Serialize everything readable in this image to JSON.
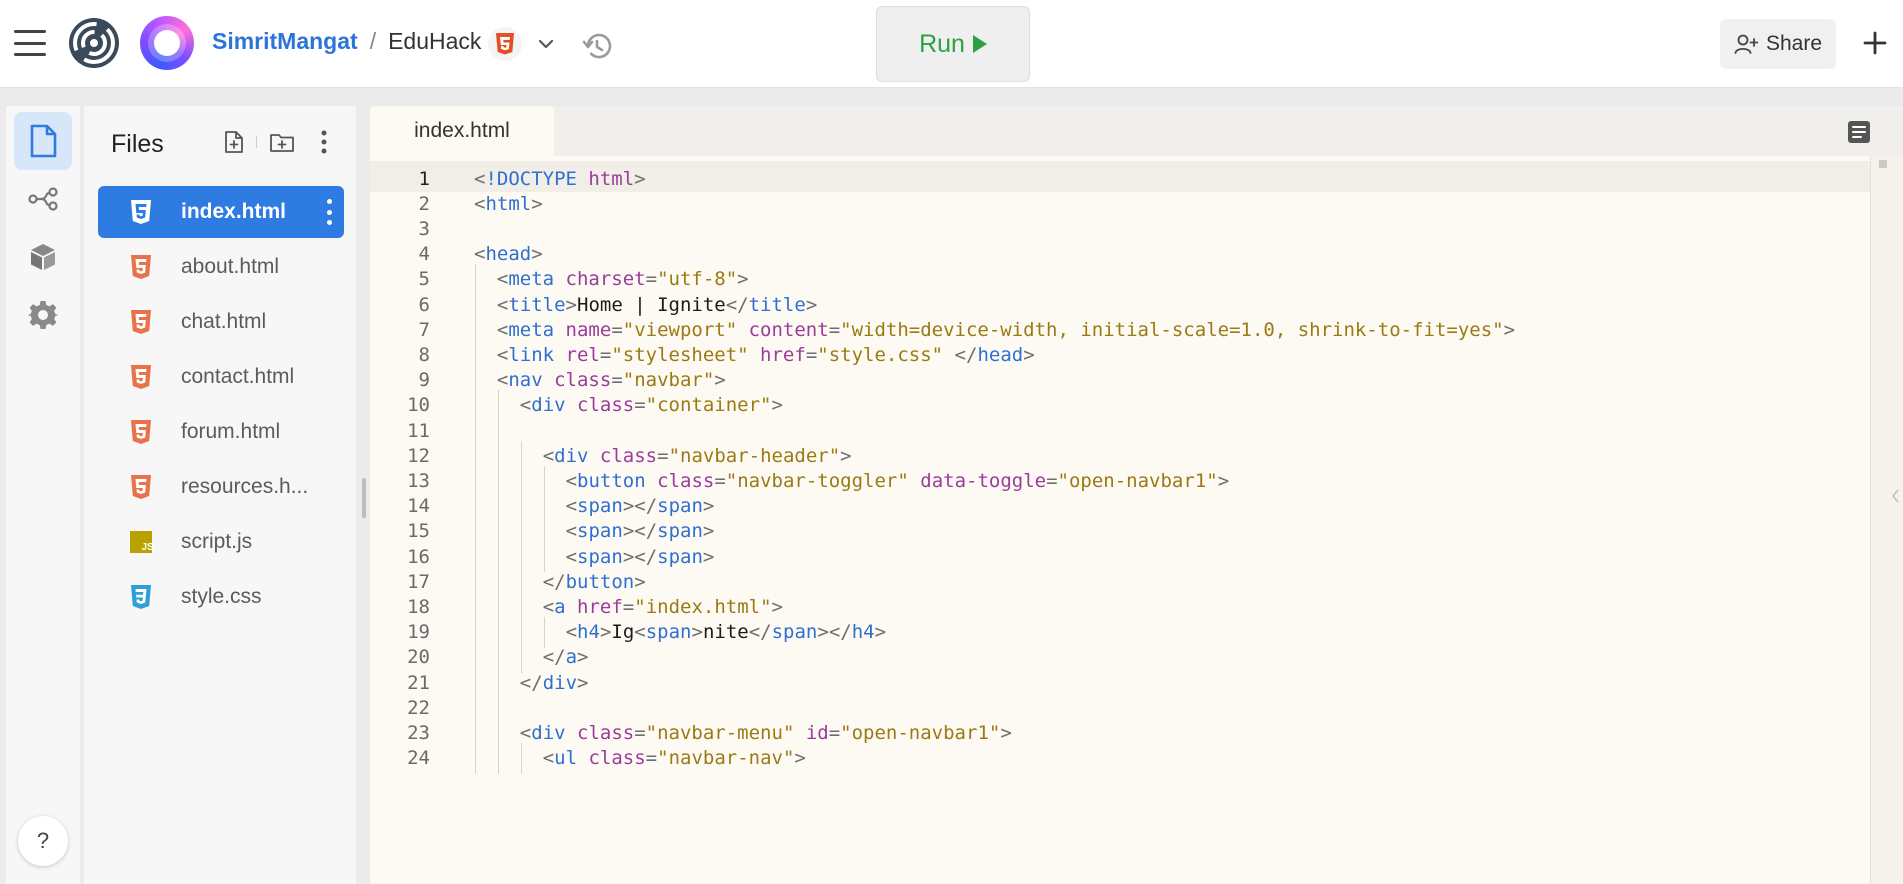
{
  "topbar": {
    "user": "SimritMangat",
    "separator": "/",
    "project": "EduHack",
    "run_label": "Run",
    "share_label": "Share"
  },
  "rail": {
    "items": [
      {
        "name": "files-icon",
        "active": true
      },
      {
        "name": "git-icon",
        "active": false
      },
      {
        "name": "packages-icon",
        "active": false
      },
      {
        "name": "settings-icon",
        "active": false
      }
    ],
    "help_label": "?"
  },
  "files": {
    "title": "Files",
    "items": [
      {
        "label": "index.html",
        "type": "html",
        "active": true
      },
      {
        "label": "about.html",
        "type": "html",
        "active": false
      },
      {
        "label": "chat.html",
        "type": "html",
        "active": false
      },
      {
        "label": "contact.html",
        "type": "html",
        "active": false
      },
      {
        "label": "forum.html",
        "type": "html",
        "active": false
      },
      {
        "label": "resources.h...",
        "type": "html",
        "active": false
      },
      {
        "label": "script.js",
        "type": "js",
        "active": false
      },
      {
        "label": "style.css",
        "type": "css",
        "active": false
      }
    ]
  },
  "editor": {
    "tab_label": "index.html",
    "current_line": 1,
    "lines": [
      {
        "n": "1",
        "indent": 0,
        "tokens": [
          [
            "b",
            "<"
          ],
          [
            "t",
            "!DOCTYPE "
          ],
          [
            "a",
            "html"
          ],
          [
            "b",
            ">"
          ]
        ]
      },
      {
        "n": "2",
        "indent": 0,
        "tokens": [
          [
            "b",
            "<"
          ],
          [
            "t",
            "html"
          ],
          [
            "b",
            ">"
          ]
        ]
      },
      {
        "n": "3",
        "indent": 0,
        "tokens": []
      },
      {
        "n": "4",
        "indent": 0,
        "tokens": [
          [
            "b",
            "<"
          ],
          [
            "t",
            "head"
          ],
          [
            "b",
            ">"
          ]
        ]
      },
      {
        "n": "5",
        "indent": 1,
        "tokens": [
          [
            "b",
            "<"
          ],
          [
            "t",
            "meta "
          ],
          [
            "a",
            "charset"
          ],
          [
            "b",
            "="
          ],
          [
            "s",
            "\"utf-8\""
          ],
          [
            "b",
            ">"
          ]
        ]
      },
      {
        "n": "6",
        "indent": 1,
        "tokens": [
          [
            "b",
            "<"
          ],
          [
            "t",
            "title"
          ],
          [
            "b",
            ">"
          ],
          [
            "x",
            "Home | Ignite"
          ],
          [
            "b",
            "</"
          ],
          [
            "t",
            "title"
          ],
          [
            "b",
            ">"
          ]
        ]
      },
      {
        "n": "7",
        "indent": 1,
        "tokens": [
          [
            "b",
            "<"
          ],
          [
            "t",
            "meta "
          ],
          [
            "a",
            "name"
          ],
          [
            "b",
            "="
          ],
          [
            "s",
            "\"viewport\" "
          ],
          [
            "a",
            "content"
          ],
          [
            "b",
            "="
          ],
          [
            "s",
            "\"width=device-width, initial-scale=1.0, shrink-to-fit=yes\""
          ],
          [
            "b",
            ">"
          ]
        ]
      },
      {
        "n": "8",
        "indent": 1,
        "tokens": [
          [
            "b",
            "<"
          ],
          [
            "t",
            "link "
          ],
          [
            "a",
            "rel"
          ],
          [
            "b",
            "="
          ],
          [
            "s",
            "\"stylesheet\" "
          ],
          [
            "a",
            "href"
          ],
          [
            "b",
            "="
          ],
          [
            "s",
            "\"style.css\" "
          ],
          [
            "b",
            "</"
          ],
          [
            "t",
            "head"
          ],
          [
            "b",
            ">"
          ]
        ]
      },
      {
        "n": "9",
        "indent": 1,
        "tokens": [
          [
            "b",
            "<"
          ],
          [
            "t",
            "nav "
          ],
          [
            "a",
            "class"
          ],
          [
            "b",
            "="
          ],
          [
            "s",
            "\"navbar\""
          ],
          [
            "b",
            ">"
          ]
        ]
      },
      {
        "n": "10",
        "indent": 2,
        "tokens": [
          [
            "b",
            "<"
          ],
          [
            "t",
            "div "
          ],
          [
            "a",
            "class"
          ],
          [
            "b",
            "="
          ],
          [
            "s",
            "\"container\""
          ],
          [
            "b",
            ">"
          ]
        ]
      },
      {
        "n": "11",
        "indent": 2,
        "tokens": []
      },
      {
        "n": "12",
        "indent": 3,
        "tokens": [
          [
            "b",
            "<"
          ],
          [
            "t",
            "div "
          ],
          [
            "a",
            "class"
          ],
          [
            "b",
            "="
          ],
          [
            "s",
            "\"navbar-header\""
          ],
          [
            "b",
            ">"
          ]
        ]
      },
      {
        "n": "13",
        "indent": 4,
        "tokens": [
          [
            "b",
            "<"
          ],
          [
            "t",
            "button "
          ],
          [
            "a",
            "class"
          ],
          [
            "b",
            "="
          ],
          [
            "s",
            "\"navbar-toggler\" "
          ],
          [
            "a",
            "data-toggle"
          ],
          [
            "b",
            "="
          ],
          [
            "s",
            "\"open-navbar1\""
          ],
          [
            "b",
            ">"
          ]
        ]
      },
      {
        "n": "14",
        "indent": 4,
        "tokens": [
          [
            "b",
            "<"
          ],
          [
            "t",
            "span"
          ],
          [
            "b",
            "></"
          ],
          [
            "t",
            "span"
          ],
          [
            "b",
            ">"
          ]
        ]
      },
      {
        "n": "15",
        "indent": 4,
        "tokens": [
          [
            "b",
            "<"
          ],
          [
            "t",
            "span"
          ],
          [
            "b",
            "></"
          ],
          [
            "t",
            "span"
          ],
          [
            "b",
            ">"
          ]
        ]
      },
      {
        "n": "16",
        "indent": 4,
        "tokens": [
          [
            "b",
            "<"
          ],
          [
            "t",
            "span"
          ],
          [
            "b",
            "></"
          ],
          [
            "t",
            "span"
          ],
          [
            "b",
            ">"
          ]
        ]
      },
      {
        "n": "17",
        "indent": 3,
        "tokens": [
          [
            "b",
            "</"
          ],
          [
            "t",
            "button"
          ],
          [
            "b",
            ">"
          ]
        ]
      },
      {
        "n": "18",
        "indent": 3,
        "tokens": [
          [
            "b",
            "<"
          ],
          [
            "t",
            "a "
          ],
          [
            "a",
            "href"
          ],
          [
            "b",
            "="
          ],
          [
            "s",
            "\"index.html\""
          ],
          [
            "b",
            ">"
          ]
        ]
      },
      {
        "n": "19",
        "indent": 4,
        "tokens": [
          [
            "b",
            "<"
          ],
          [
            "t",
            "h4"
          ],
          [
            "b",
            ">"
          ],
          [
            "x",
            "Ig"
          ],
          [
            "b",
            "<"
          ],
          [
            "t",
            "span"
          ],
          [
            "b",
            ">"
          ],
          [
            "x",
            "nite"
          ],
          [
            "b",
            "</"
          ],
          [
            "t",
            "span"
          ],
          [
            "b",
            "></"
          ],
          [
            "t",
            "h4"
          ],
          [
            "b",
            ">"
          ]
        ]
      },
      {
        "n": "20",
        "indent": 3,
        "tokens": [
          [
            "b",
            "</"
          ],
          [
            "t",
            "a"
          ],
          [
            "b",
            ">"
          ]
        ]
      },
      {
        "n": "21",
        "indent": 2,
        "tokens": [
          [
            "b",
            "</"
          ],
          [
            "t",
            "div"
          ],
          [
            "b",
            ">"
          ]
        ]
      },
      {
        "n": "22",
        "indent": 2,
        "tokens": []
      },
      {
        "n": "23",
        "indent": 2,
        "tokens": [
          [
            "b",
            "<"
          ],
          [
            "t",
            "div "
          ],
          [
            "a",
            "class"
          ],
          [
            "b",
            "="
          ],
          [
            "s",
            "\"navbar-menu\" "
          ],
          [
            "a",
            "id"
          ],
          [
            "b",
            "="
          ],
          [
            "s",
            "\"open-navbar1\""
          ],
          [
            "b",
            ">"
          ]
        ]
      },
      {
        "n": "24",
        "indent": 3,
        "tokens": [
          [
            "b",
            "<"
          ],
          [
            "t",
            "ul "
          ],
          [
            "a",
            "class"
          ],
          [
            "b",
            "="
          ],
          [
            "s",
            "\"navbar-nav\""
          ],
          [
            "b",
            ">"
          ]
        ]
      }
    ]
  },
  "colors": {
    "accent": "#2e7be2",
    "run_green": "#2ea043",
    "html_icon": "#e8734a",
    "css_icon": "#2f9fd8",
    "js_icon": "#b8a200"
  }
}
